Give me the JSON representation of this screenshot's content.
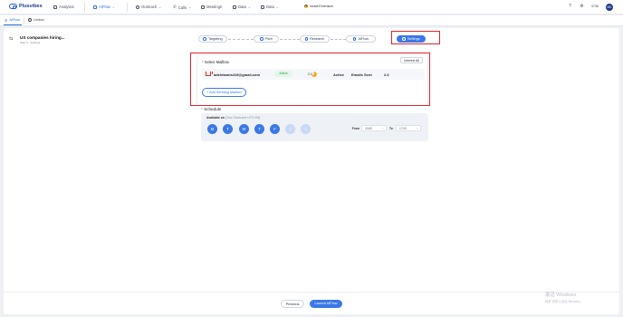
{
  "app": {
    "brand": "Plusvibes"
  },
  "topnav": {
    "items": [
      {
        "label": "Analytics",
        "icon": "chart-icon"
      },
      {
        "label": "AIFlow",
        "icon": "flow-icon"
      },
      {
        "label": "Outreach",
        "icon": "outreach-icon"
      },
      {
        "label": "Calls",
        "icon": "phone-icon"
      },
      {
        "label": "Meetings",
        "icon": "calendar-icon"
      },
      {
        "label": "Data",
        "icon": "database-icon"
      },
      {
        "label": "Data",
        "icon": "database-icon"
      }
    ],
    "extension_label": "Install Extension",
    "credits": "4736",
    "avatar_initials": "MD"
  },
  "tabs": [
    {
      "label": "AIFlow"
    },
    {
      "label": "Unibox"
    }
  ],
  "campaign": {
    "title": "US companies hiring...",
    "subtitle": "Step 5 - Settings"
  },
  "steps": [
    {
      "label": "Targeting"
    },
    {
      "label": "Pitch"
    },
    {
      "label": "Research"
    },
    {
      "label": "AIFlow"
    },
    {
      "label": "Settings"
    }
  ],
  "mailbox": {
    "title": "Select Mailbox",
    "interest_button": "Interest All",
    "row": {
      "email": "adeletamis419@gmail.com",
      "status": "Active",
      "health": "2.6",
      "state": "Active",
      "sent_label": "Emails Sent",
      "sent_value": "2.6"
    },
    "add_button": "+ Add Sending Mailbox"
  },
  "schedule": {
    "title": "Schedule",
    "available_on_label": "Available on",
    "timezone": "(Your Timezone UTC+08)",
    "days": [
      {
        "label": "M",
        "enabled": true
      },
      {
        "label": "T",
        "enabled": true
      },
      {
        "label": "W",
        "enabled": true
      },
      {
        "label": "T",
        "enabled": true
      },
      {
        "label": "F",
        "enabled": true
      },
      {
        "label": "S",
        "enabled": false
      },
      {
        "label": "S",
        "enabled": false
      }
    ],
    "from_label": "From",
    "from_value": "10:00",
    "to_label": "To",
    "to_value": "17:00"
  },
  "footer": {
    "previous": "Previous",
    "launch": "Launch AIFlow"
  },
  "watermark": {
    "line1": "激活 Windows",
    "line2": "转到\"设置\"以激活 Windows。"
  },
  "colors": {
    "accent": "#3b78e7",
    "highlight": "#d9262c",
    "active_green": "#2e9e4f"
  }
}
